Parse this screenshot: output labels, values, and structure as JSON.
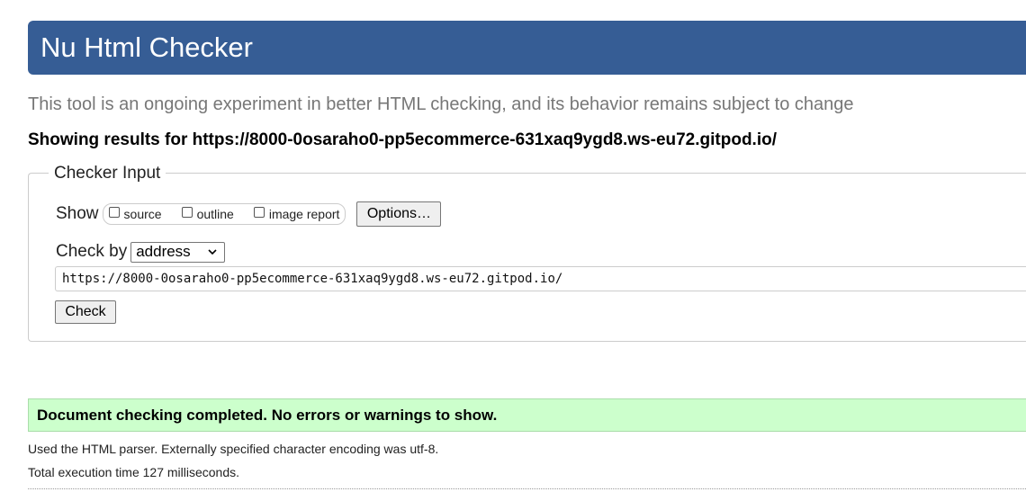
{
  "header": {
    "title": "Nu Html Checker"
  },
  "tagline": "This tool is an ongoing experiment in better HTML checking, and its behavior remains subject to change",
  "results_heading": "Showing results for https://8000-0osaraho0-pp5ecommerce-631xaq9ygd8.ws-eu72.gitpod.io/",
  "checker_input": {
    "legend": "Checker Input",
    "show_label": "Show",
    "show_options": [
      {
        "label": "source",
        "checked": false
      },
      {
        "label": "outline",
        "checked": false
      },
      {
        "label": "image report",
        "checked": false
      }
    ],
    "options_button": "Options…",
    "check_by_label": "Check by",
    "check_by_selected": "address",
    "url_value": "https://8000-0osaraho0-pp5ecommerce-631xaq9ygd8.ws-eu72.gitpod.io/",
    "check_button": "Check"
  },
  "result": {
    "success_message": "Document checking completed. No errors or warnings to show.",
    "parser_info": "Used the HTML parser. Externally specified character encoding was utf-8.",
    "execution_time": "Total execution time 127 milliseconds."
  },
  "colors": {
    "header_bg": "#365d95",
    "success_bg": "#ccffcc",
    "tagline_text": "#777777"
  },
  "icons": {
    "select_arrow": "chevron-down-icon"
  }
}
